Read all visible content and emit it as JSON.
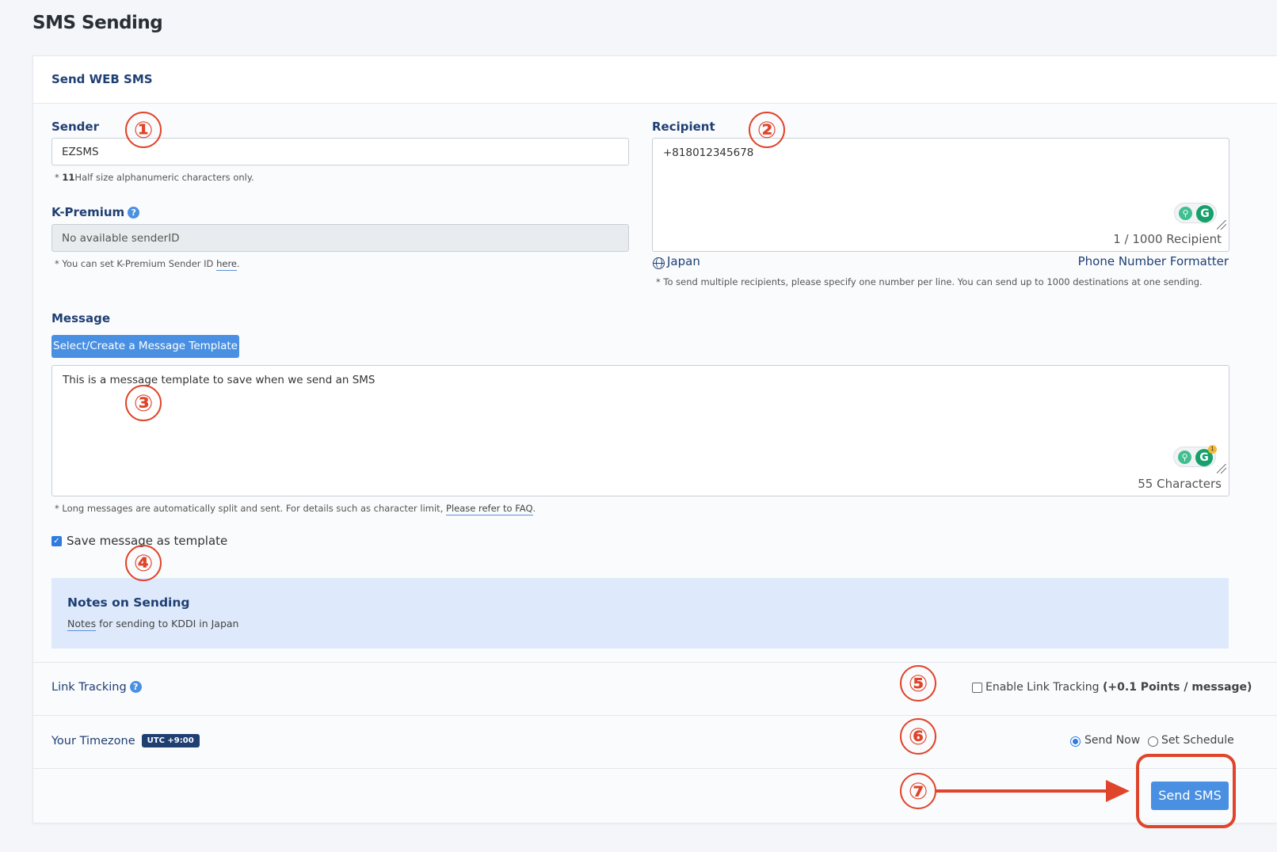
{
  "page": {
    "title": "SMS Sending"
  },
  "card": {
    "header": "Send WEB SMS"
  },
  "sender": {
    "label": "Sender",
    "value": "EZSMS",
    "hint_prefix": "* ",
    "hint_bold": "11",
    "hint_rest": "Half size alphanumeric characters only."
  },
  "kpremium": {
    "label": "K-Premium",
    "help": "?",
    "value": "No available senderID",
    "hint_prefix": "* You can set K-Premium Sender ID ",
    "hint_link": "here",
    "hint_suffix": "."
  },
  "recipient": {
    "label": "Recipient",
    "value": "+818012345678",
    "counter": "1 / 1000 Recipient",
    "country": "Japan",
    "formatter": "Phone Number Formatter",
    "hint": "* To send multiple recipients, please specify one number per line. You can send up to 1000 destinations at one sending."
  },
  "message": {
    "label": "Message",
    "template_button": "Select/Create a Message Template",
    "value": "This is a  message template to save when we send an SMS",
    "counter": "55 Characters",
    "hint_prefix": "* Long messages are automatically split and sent. For details such as character limit, ",
    "hint_link": "Please refer to FAQ",
    "hint_suffix": ".",
    "save_template_label": "Save message as template",
    "save_template_checked": true
  },
  "grammarly": {
    "bulb": "⚲",
    "g": "G",
    "badge": "1"
  },
  "notes": {
    "title": "Notes on Sending",
    "link": "Notes",
    "text": " for sending to KDDI in Japan"
  },
  "link_tracking": {
    "label": "Link Tracking",
    "help": "?",
    "option_label": "Enable Link Tracking ",
    "option_bold": "(+0.1 Points / message)",
    "checked": false
  },
  "timezone": {
    "label": "Your Timezone",
    "badge": "UTC +9:00",
    "send_now": "Send Now",
    "set_schedule": "Set Schedule",
    "selected": "send_now"
  },
  "send_button": "Send SMS",
  "annotations": [
    "①",
    "②",
    "③",
    "④",
    "⑤",
    "⑥",
    "⑦"
  ],
  "colors": {
    "accent": "#4a90e2",
    "navy": "#1f3f73",
    "annotation": "#e0442a",
    "notes_bg": "#deeafb"
  }
}
